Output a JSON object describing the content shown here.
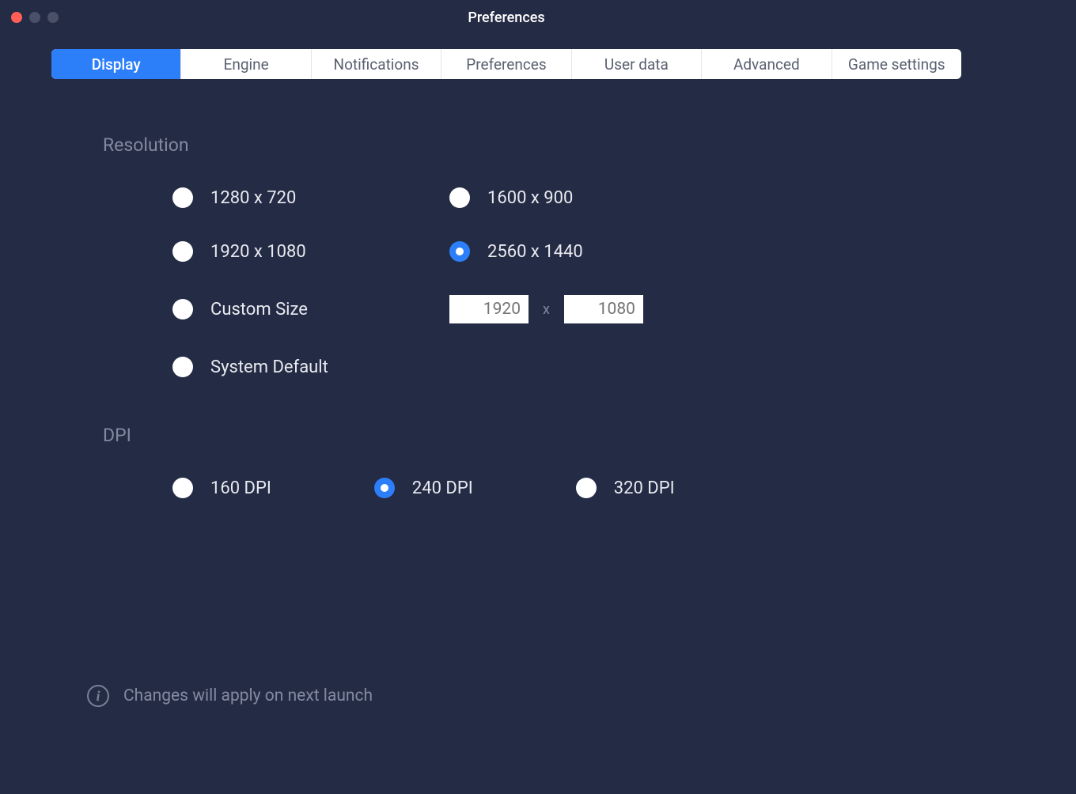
{
  "window": {
    "title": "Preferences"
  },
  "tabs": [
    {
      "label": "Display",
      "active": true
    },
    {
      "label": "Engine",
      "active": false
    },
    {
      "label": "Notifications",
      "active": false
    },
    {
      "label": "Preferences",
      "active": false
    },
    {
      "label": "User data",
      "active": false
    },
    {
      "label": "Advanced",
      "active": false
    },
    {
      "label": "Game settings",
      "active": false
    }
  ],
  "sections": {
    "resolution": {
      "title": "Resolution",
      "options": [
        {
          "label": "1280 x 720",
          "selected": false
        },
        {
          "label": "1600 x 900",
          "selected": false
        },
        {
          "label": "1920 x 1080",
          "selected": false
        },
        {
          "label": "2560 x 1440",
          "selected": true
        },
        {
          "label": "Custom Size",
          "selected": false
        },
        {
          "label": "System Default",
          "selected": false
        }
      ],
      "custom": {
        "width": "1920",
        "height": "1080",
        "separator": "x"
      }
    },
    "dpi": {
      "title": "DPI",
      "options": [
        {
          "label": "160 DPI",
          "selected": false
        },
        {
          "label": "240 DPI",
          "selected": true
        },
        {
          "label": "320 DPI",
          "selected": false
        }
      ]
    }
  },
  "footer": {
    "message": "Changes will apply on next launch"
  }
}
